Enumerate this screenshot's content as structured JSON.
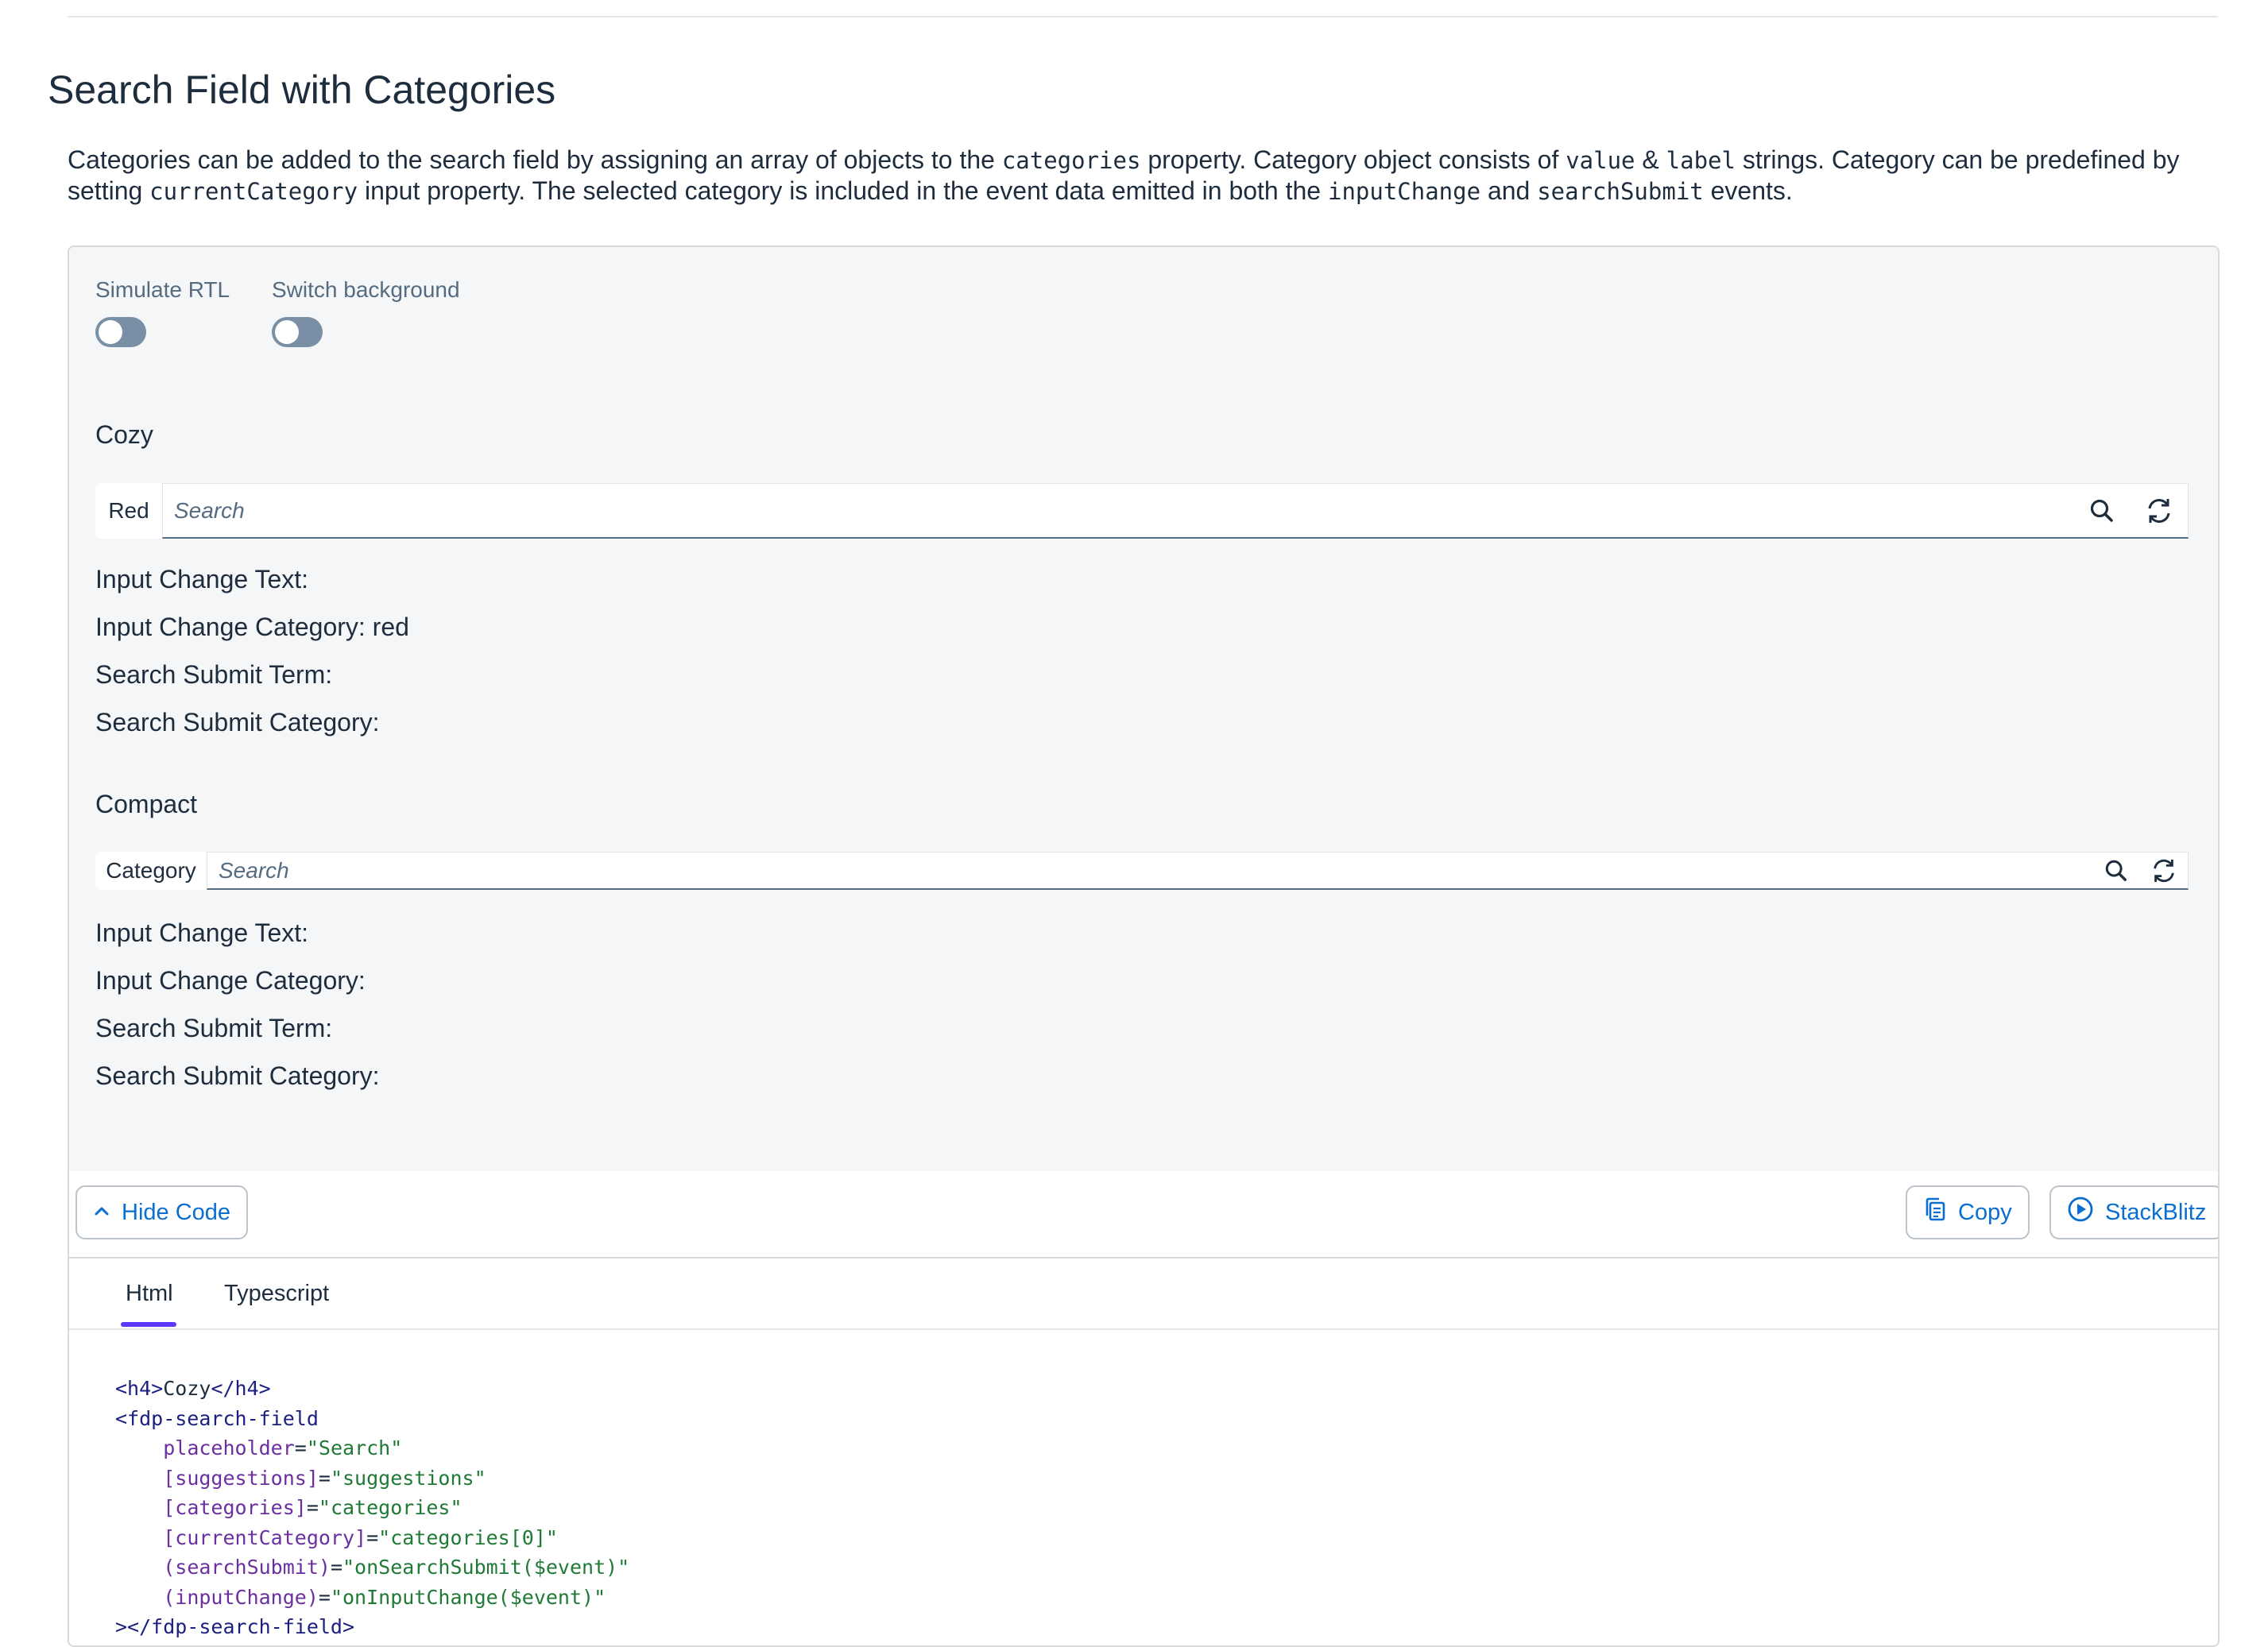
{
  "page": {
    "title": "Search Field with Categories",
    "description": [
      {
        "t": "Categories can be added to the search field by assigning an array of objects to the "
      },
      {
        "c": "categories"
      },
      {
        "t": " property. Category object consists of "
      },
      {
        "c": "value"
      },
      {
        "t": " & "
      },
      {
        "c": "label"
      },
      {
        "t": " strings. Category can be predefined by setting "
      },
      {
        "c": "currentCategory"
      },
      {
        "t": " input property. The selected category is included in the event data emitted in both the "
      },
      {
        "c": "inputChange"
      },
      {
        "t": " and "
      },
      {
        "c": "searchSubmit"
      },
      {
        "t": " events."
      }
    ]
  },
  "toggles": {
    "rtl_label": "Simulate RTL",
    "rtl_on": false,
    "bg_label": "Switch background",
    "bg_on": false
  },
  "cozy": {
    "heading": "Cozy",
    "category_label": "Red",
    "placeholder": "Search",
    "input_change_text": "Input Change Text:",
    "input_change_category": "Input Change Category: red",
    "search_submit_term": "Search Submit Term:",
    "search_submit_category": "Search Submit Category:"
  },
  "compact": {
    "heading": "Compact",
    "category_label": "Category",
    "placeholder": "Search",
    "input_change_text": "Input Change Text:",
    "input_change_category": "Input Change Category:",
    "search_submit_term": "Search Submit Term:",
    "search_submit_category": "Search Submit Category:"
  },
  "toolbar": {
    "hide_code_label": "Hide Code",
    "copy_label": "Copy",
    "stackblitz_label": "StackBlitz"
  },
  "code_tabs": [
    {
      "label": "Html",
      "active": true
    },
    {
      "label": "Typescript",
      "active": false
    }
  ],
  "code_lines": [
    [
      {
        "k": "tag",
        "v": "<h4>"
      },
      {
        "k": "txt",
        "v": "Cozy"
      },
      {
        "k": "tag",
        "v": "</h4>"
      }
    ],
    [
      {
        "k": "tag",
        "v": "<fdp-search-field"
      }
    ],
    [
      {
        "k": "txt",
        "v": "    "
      },
      {
        "k": "attr",
        "v": "placeholder"
      },
      {
        "k": "txt",
        "v": "="
      },
      {
        "k": "str",
        "v": "\"Search\""
      }
    ],
    [
      {
        "k": "txt",
        "v": "    "
      },
      {
        "k": "attr",
        "v": "[suggestions]"
      },
      {
        "k": "txt",
        "v": "="
      },
      {
        "k": "str",
        "v": "\"suggestions\""
      }
    ],
    [
      {
        "k": "txt",
        "v": "    "
      },
      {
        "k": "attr",
        "v": "[categories]"
      },
      {
        "k": "txt",
        "v": "="
      },
      {
        "k": "str",
        "v": "\"categories\""
      }
    ],
    [
      {
        "k": "txt",
        "v": "    "
      },
      {
        "k": "attr",
        "v": "[currentCategory]"
      },
      {
        "k": "txt",
        "v": "="
      },
      {
        "k": "str",
        "v": "\"categories[0]\""
      }
    ],
    [
      {
        "k": "txt",
        "v": "    "
      },
      {
        "k": "attr",
        "v": "(searchSubmit)"
      },
      {
        "k": "txt",
        "v": "="
      },
      {
        "k": "str",
        "v": "\"onSearchSubmit($event)\""
      }
    ],
    [
      {
        "k": "txt",
        "v": "    "
      },
      {
        "k": "attr",
        "v": "(inputChange)"
      },
      {
        "k": "txt",
        "v": "="
      },
      {
        "k": "str",
        "v": "\"onInputChange($event)\""
      }
    ],
    [
      {
        "k": "tag",
        "v": "></fdp-search-field>"
      }
    ]
  ],
  "icons": {
    "search": "search-icon",
    "refresh": "refresh-icon",
    "chevron": "chevron-up-icon",
    "copy": "copy-icon",
    "play": "play-circle-icon"
  },
  "colors": {
    "accent": "#0a6ed1",
    "tab_indicator": "#5d36ff",
    "preview_bg": "#f5f6f7",
    "switch_off": "#788fa6"
  }
}
